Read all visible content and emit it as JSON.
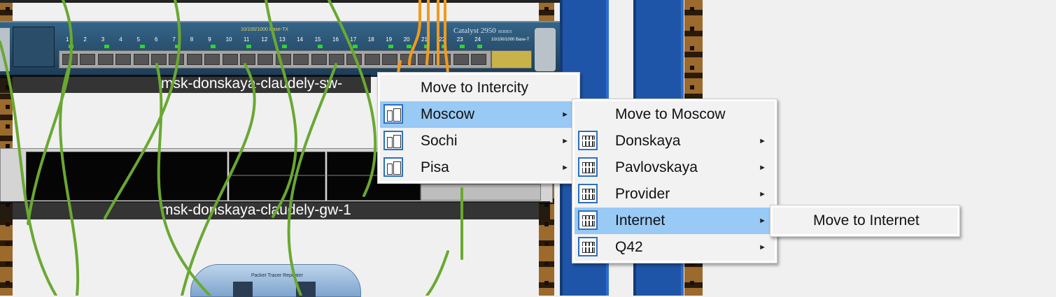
{
  "devices": {
    "switch": {
      "label": "msk-donskaya-claudely-sw-",
      "model": "Catalyst 2950",
      "model_suffix": "SERIES",
      "ports_caption": "10/100/1000 Base-TX",
      "uplink_caption": "10/100/1000 Base-T",
      "port_numbers": [
        "1",
        "2",
        "3",
        "4",
        "5",
        "6",
        "7",
        "8",
        "9",
        "10",
        "11",
        "12",
        "13",
        "14",
        "15",
        "16",
        "17",
        "18",
        "19",
        "20",
        "21",
        "22",
        "23",
        "24"
      ]
    },
    "gateway": {
      "label": "msk-donskaya-claudely-gw-1"
    },
    "repeater": {
      "caption": "Packet Tracer Repeater"
    }
  },
  "menus": {
    "root": {
      "items": [
        {
          "label": "Move to Intercity",
          "icon": "none",
          "submenu": false,
          "active": false
        },
        {
          "label": "Moscow",
          "icon": "city-icon",
          "submenu": true,
          "active": true
        },
        {
          "label": "Sochi",
          "icon": "city-icon",
          "submenu": true,
          "active": false
        },
        {
          "label": "Pisa",
          "icon": "city-icon",
          "submenu": true,
          "active": false
        }
      ]
    },
    "moscow": {
      "items": [
        {
          "label": "Move to Moscow",
          "icon": "none",
          "submenu": false,
          "active": false
        },
        {
          "label": "Donskaya",
          "icon": "building-icon",
          "submenu": true,
          "active": false
        },
        {
          "label": "Pavlovskaya",
          "icon": "building-icon",
          "submenu": true,
          "active": false
        },
        {
          "label": "Provider",
          "icon": "building-icon",
          "submenu": true,
          "active": false
        },
        {
          "label": "Internet",
          "icon": "building-icon",
          "submenu": true,
          "active": true
        },
        {
          "label": "Q42",
          "icon": "building-icon",
          "submenu": true,
          "active": false
        }
      ]
    },
    "internet": {
      "items": [
        {
          "label": "Move to Internet",
          "icon": "none",
          "submenu": false,
          "active": false
        }
      ]
    },
    "arrow_glyph": "►"
  },
  "colors": {
    "menu_highlight": "#99c9f5",
    "cable_green": "#6aa832",
    "cable_orange": "#f09a1e",
    "rack_blue": "#1f55a8"
  }
}
